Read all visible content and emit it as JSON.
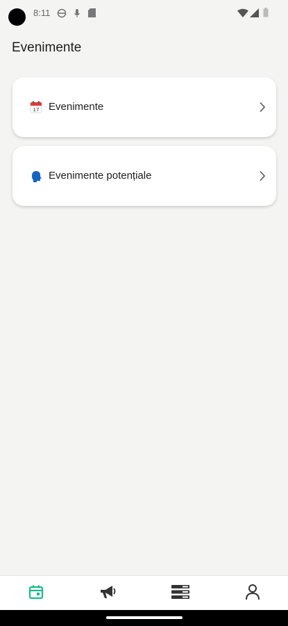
{
  "status_bar": {
    "time": "8:11",
    "left_icons": [
      "vpn-icon",
      "mic-icon",
      "sd-card-icon"
    ],
    "right_icons": [
      "wifi-icon",
      "signal-icon",
      "battery-icon"
    ]
  },
  "header": {
    "title": "Evenimente"
  },
  "cards": [
    {
      "icon": "calendar-emoji-icon",
      "label": "Evenimente"
    },
    {
      "icon": "speaking-head-icon",
      "label": "Evenimente potențiale"
    }
  ],
  "bottom_nav": {
    "items": [
      {
        "icon": "calendar-icon",
        "active": true
      },
      {
        "icon": "megaphone-icon",
        "active": false
      },
      {
        "icon": "list-icon",
        "active": false
      },
      {
        "icon": "person-icon",
        "active": false
      }
    ],
    "active_color": "#1cb98c",
    "inactive_color": "#333333"
  }
}
